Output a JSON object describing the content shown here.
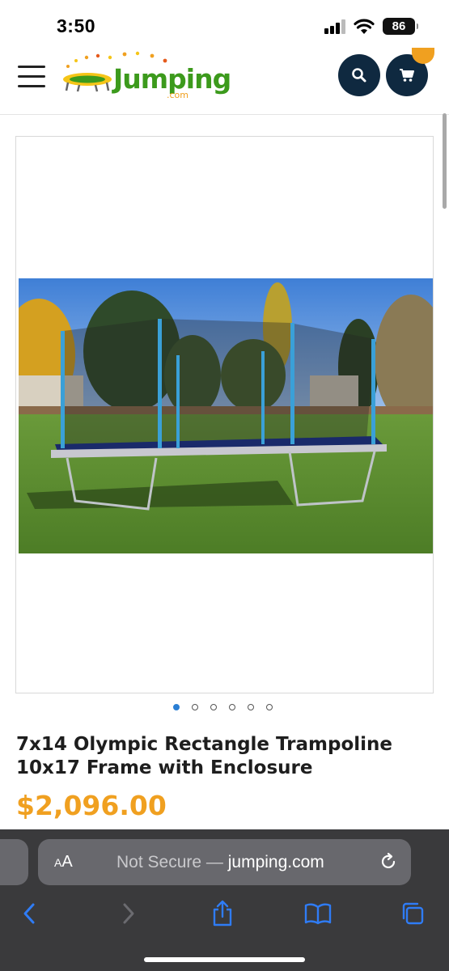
{
  "status_bar": {
    "time": "3:50",
    "battery": "86"
  },
  "site": {
    "logo_main": "Jumping",
    "logo_sub": ".com"
  },
  "product": {
    "title": "7x14 Olympic Rectangle Trampoline 10x17 Frame with Enclosure",
    "price": "$2,096.00",
    "image_count": 6,
    "active_image": 1
  },
  "browser": {
    "aa_large": "A",
    "aa_small": "A",
    "security_label": "Not Secure —",
    "domain": "jumping.com"
  },
  "icons": {
    "menu": "hamburger-icon",
    "search": "search-icon",
    "cart": "cart-icon",
    "back": "chevron-left-icon",
    "forward": "chevron-right-icon",
    "share": "share-icon",
    "bookmarks": "book-icon",
    "tabs": "tabs-icon",
    "reload": "reload-icon"
  },
  "colors": {
    "brand_navy": "#0f2940",
    "price_orange": "#f0a020",
    "logo_green": "#3c9a1c",
    "safari_blue": "#2f7cf6",
    "browser_bar": "#3a3a3c"
  }
}
